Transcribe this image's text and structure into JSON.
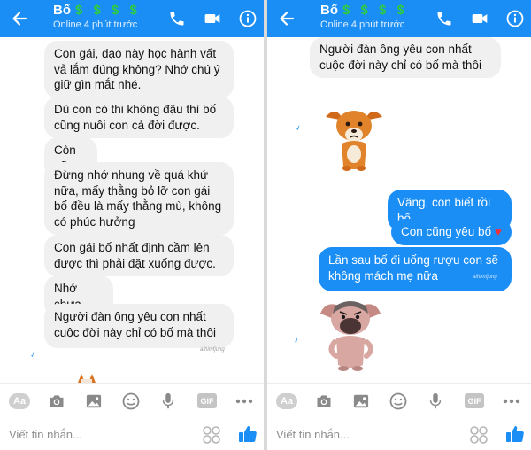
{
  "colors": {
    "accent": "#1a8ef5",
    "incoming_bubble": "#f0f0f0",
    "dollar": "#2ecc40",
    "heart": "#f0303a"
  },
  "left": {
    "header": {
      "name": "Bố",
      "dollars": "$ $ $ $",
      "status": "Online 4 phút trước"
    },
    "messages": [
      {
        "text": "Con gái, dạo này học hành vất vả lắm đúng không? Nhớ chú ý giữ gìn mắt nhé."
      },
      {
        "text": "Dù con có thi không đậu  thì bố cũng nuôi con cả đời được."
      },
      {
        "text": "Còn nữa"
      },
      {
        "text": "Đừng nhớ nhung về quá khứ nữa, mấy thằng bỏ lỡ con gái bố đều là mấy thằng mù, không có phúc hưởng"
      },
      {
        "text": "Con gái bố nhất định cầm lên được thì phải đặt xuống được."
      },
      {
        "text": "Nhớ chưa"
      },
      {
        "text": "Người đàn ông yêu con nhất cuộc đời này chỉ có bố mà thôi"
      }
    ],
    "signature": "afhimfjung",
    "input_placeholder": "Viết tin nhắn..."
  },
  "right": {
    "header": {
      "name": "Bố",
      "dollars": "$ $ $ $",
      "status": "Online 4 phút trước"
    },
    "messages_in": [
      {
        "text": "Người đàn ông yêu con nhất cuộc đời này chỉ có bố mà thôi"
      }
    ],
    "messages_out": [
      {
        "text": "Vâng, con biết rồi bố"
      },
      {
        "text": "Con cũng yêu bố"
      },
      {
        "text": "Lần sau bố đi uống rượu con sẽ không mách mẹ nữa"
      }
    ],
    "signature": "afhimfjung",
    "input_placeholder": "Viết tin nhắn..."
  },
  "toolbar": {
    "aa_label": "Aa",
    "gif_label": "GIF"
  },
  "icons": [
    "back-arrow-icon",
    "phone-icon",
    "video-icon",
    "info-icon",
    "camera-icon",
    "image-icon",
    "emoji-icon",
    "microphone-icon",
    "more-icon",
    "thumbs-up-icon"
  ]
}
